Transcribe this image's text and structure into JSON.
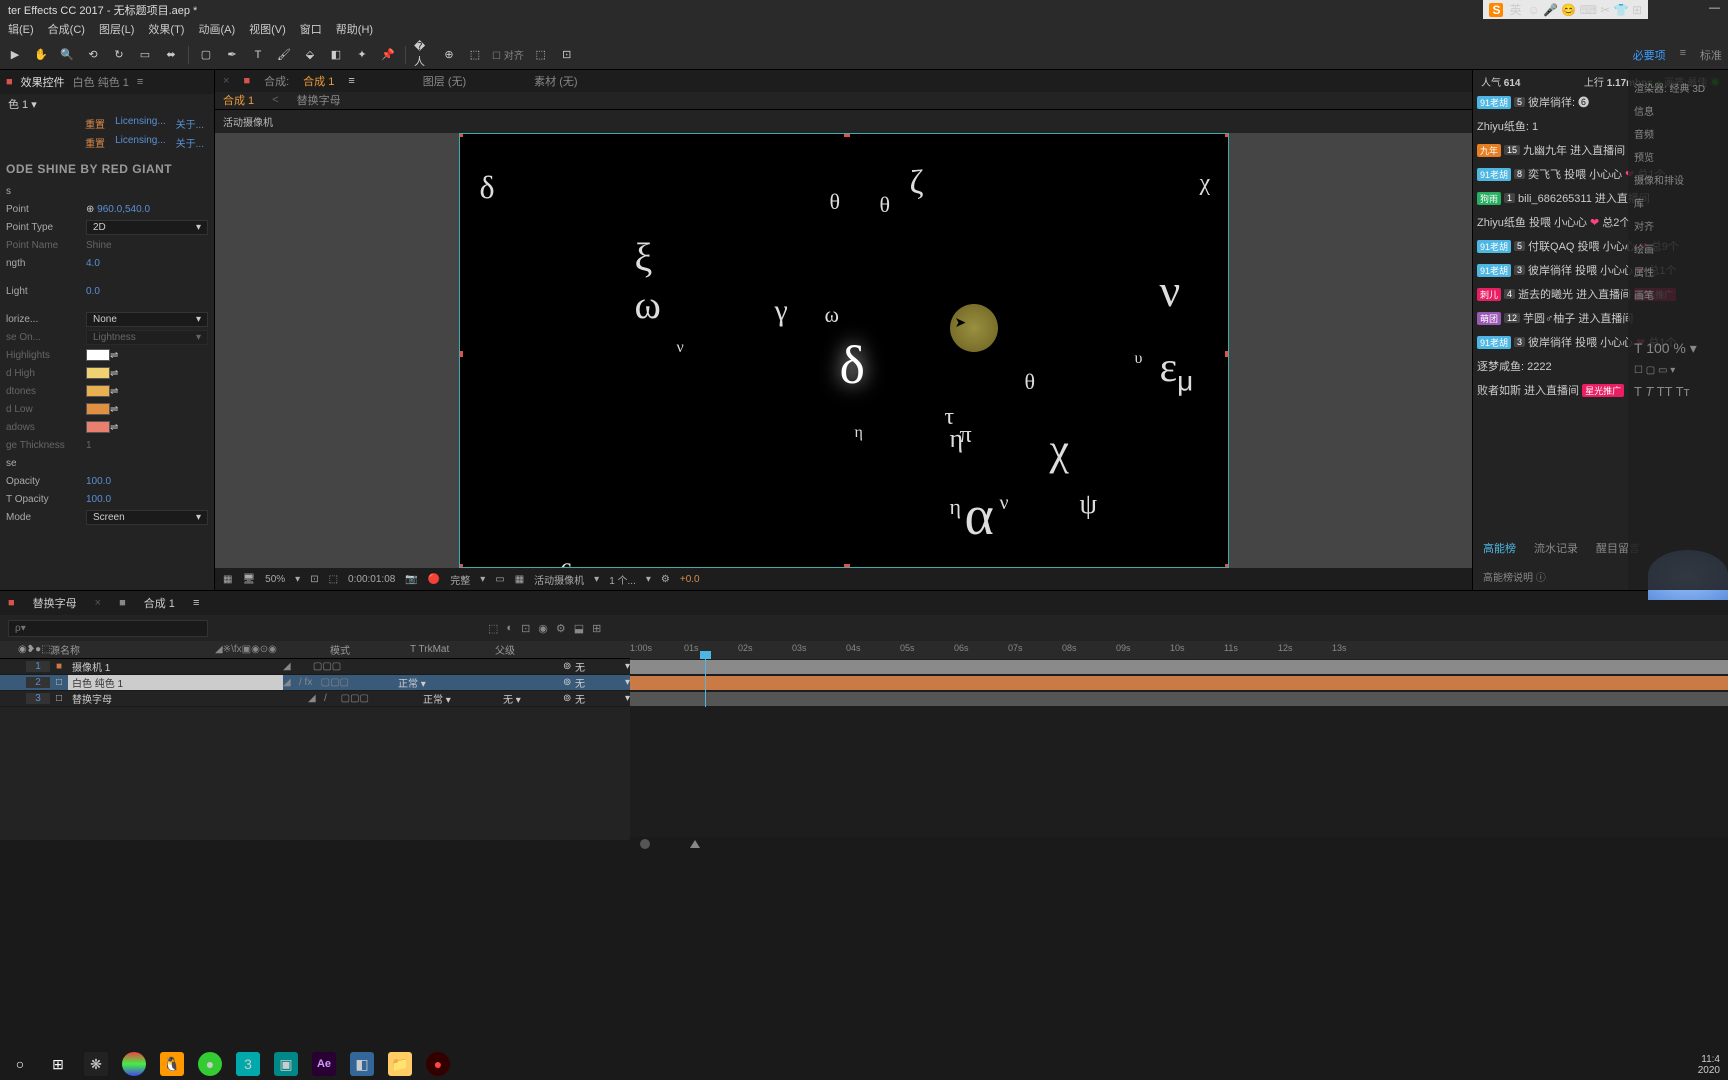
{
  "title": "ter Effects CC 2017 - 无标题项目.aep *",
  "menus": [
    "辑(E)",
    "合成(C)",
    "图层(L)",
    "效果(T)",
    "动画(A)",
    "视图(V)",
    "窗口",
    "帮助(H)"
  ],
  "toolbar_right": {
    "active": "必要项",
    "normal": "标准"
  },
  "panel": {
    "tabs": [
      "■",
      "效果控件",
      "白色 纯色 1",
      "≡"
    ],
    "sub": "色 1 ▾",
    "license": {
      "reset": "重置",
      "licensing": "Licensing...",
      "about": "关于..."
    },
    "shine": "ODE SHINE BY RED GIANT",
    "s_label": "s",
    "props": {
      "point": "Point",
      "point_val": "960.0,540.0",
      "ptype": "Point Type",
      "ptype_val": "2D",
      "pname": "Point Name",
      "pname_val": "Shine",
      "length": "ngth",
      "length_val": "4.0",
      "light": "Light",
      "light_val": "0.0",
      "colorize": "lorize...",
      "colorize_val": "None",
      "seon": "se On...",
      "seon_val": "Lightness",
      "highlights": "Highlights",
      "dhigh": "d High",
      "dtones": "dtones",
      "dlow": "d Low",
      "adows": "adows",
      "thick": "ge Thickness",
      "thick_val": "1",
      "se": "se",
      "opacity": "Opacity",
      "opacity_val": "100.0",
      "topacity": "T Opacity",
      "topacity_val": "100.0",
      "mode": "Mode",
      "mode_val": "Screen"
    }
  },
  "comp": {
    "tabs": {
      "blank": "■",
      "hecheng_lbl": "合成:",
      "hecheng": "合成 1",
      "tuceng": "图层 (无)",
      "sucai": "素材 (无)"
    },
    "subtabs": {
      "hecheng": "合成 1",
      "tihuan": "替换字母"
    },
    "camera": "活动摄像机"
  },
  "viewer": {
    "zoom": "50%",
    "time": "0:00:01:08",
    "res": "完整",
    "cam": "活动摄像机",
    "views": "1 个...",
    "exp": "+0.0"
  },
  "timeline": {
    "tabs": {
      "tihuan": "替换字母",
      "hecheng": "合成 1"
    },
    "search_ph": "ρ▾",
    "cols": {
      "source": "源名称",
      "mode": "模式",
      "trk": "T  TrkMat",
      "parent": "父级"
    },
    "layers": [
      {
        "n": "1",
        "icon": "■",
        "name": "摄像机 1",
        "mode": "",
        "trk": "",
        "parent": "无"
      },
      {
        "n": "2",
        "icon": "□",
        "name": "白色 纯色 1",
        "mode": "正常",
        "trk": "",
        "parent": "无"
      },
      {
        "n": "3",
        "icon": "□",
        "name": "替换字母",
        "mode": "正常",
        "trk": "无",
        "parent": "无"
      }
    ],
    "ticks": [
      "1:00s",
      "01s",
      "02s",
      "03s",
      "04s",
      "05s",
      "06s",
      "07s",
      "08s",
      "09s",
      "10s",
      "11s",
      "12s",
      "13s"
    ],
    "normal": "正常",
    "none": "无"
  },
  "stream": {
    "pop_l": "人气",
    "pop": "614",
    "up_l": "上行",
    "up": "1.17mbps",
    "q_l": "画质:",
    "q": "最佳",
    "o": "◉"
  },
  "overlay": [
    "信息",
    "音频",
    "预览",
    "摄像和排设",
    "库",
    "对齐",
    "绘画",
    "属性",
    "画笔",
    ""
  ],
  "overlay2": {
    "render": "渲染器: 经典 3D"
  },
  "chat": [
    {
      "badges": [
        [
          "b-cyan",
          "91老胡"
        ],
        [
          "lvl",
          "5"
        ]
      ],
      "txt": "彼岸徜徉:  ❻"
    },
    {
      "badges": [],
      "txt": "Zhiyu纸鱼: 1"
    },
    {
      "badges": [
        [
          "b-orange",
          "九年"
        ],
        [
          "lvl",
          "15"
        ]
      ],
      "txt": "九幽九年 进入直播间"
    },
    {
      "badges": [
        [
          "b-cyan",
          "91老胡"
        ],
        [
          "lvl",
          "8"
        ]
      ],
      "txt": "奕飞飞 投喂 小心心 ",
      "heart": true,
      "tail": "总1个"
    },
    {
      "badges": [
        [
          "b-green",
          "狗雨"
        ],
        [
          "lvl",
          "1"
        ]
      ],
      "txt": "bili_686265311 进入直播间"
    },
    {
      "badges": [],
      "txt": "Zhiyu纸鱼 投喂 小心心 ",
      "heart": true,
      "tail": "总2个"
    },
    {
      "badges": [
        [
          "b-cyan",
          "91老胡"
        ],
        [
          "lvl",
          "5"
        ]
      ],
      "txt": "付联QAQ 投喂 小心心 ",
      "heart": true,
      "tail": "总9个"
    },
    {
      "badges": [
        [
          "b-cyan",
          "91老胡"
        ],
        [
          "lvl",
          "3"
        ]
      ],
      "txt": "彼岸徜徉 投喂 小心心 ",
      "heart": true,
      "tail": "总1个"
    },
    {
      "badges": [
        [
          "b-pink",
          "刺儿"
        ],
        [
          "lvl",
          "4"
        ]
      ],
      "txt": "逝去的曦光 进入直播间 ",
      "pill": "星光推广"
    },
    {
      "badges": [
        [
          "b-purple",
          "萌团"
        ],
        [
          "lvl",
          "12"
        ]
      ],
      "txt": "芋圆♂柚子 进入直播间"
    },
    {
      "badges": [
        [
          "b-cyan",
          "91老胡"
        ],
        [
          "lvl",
          "3"
        ]
      ],
      "txt": "彼岸徜徉 投喂 小心心 ",
      "heart": true,
      "tail": "总1个"
    },
    {
      "badges": [],
      "txt": "逐梦咸鱼: 2222"
    },
    {
      "badges": [],
      "txt": "败者如斯 进入直播间 ",
      "pill": "星光推广"
    }
  ],
  "chat_tabs": [
    "高能榜",
    "流水记录",
    "醒目留言"
  ],
  "chat_help": "高能榜说明 ⓘ",
  "ime": {
    "s": "S",
    "lang": "英"
  },
  "clock": {
    "t": "11:4",
    "d": "2020"
  }
}
